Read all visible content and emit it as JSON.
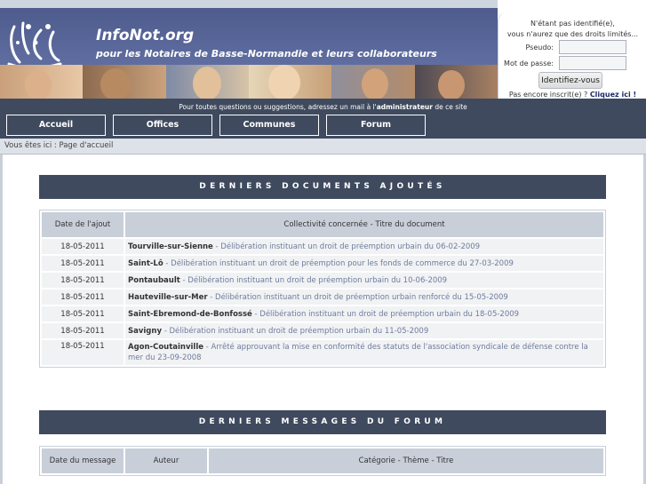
{
  "site": {
    "title": "InfoNot.org",
    "subtitle": "pour les Notaires de Basse-Normandie et leurs collaborateurs"
  },
  "login": {
    "message_line1": "N'étant pas identifié(e),",
    "message_line2": "vous n'aurez que des droits limités...",
    "pseudo_label": "Pseudo:",
    "password_label": "Mot de passe:",
    "submit_label": "Identifiez-vous",
    "signup_prompt": "Pas encore inscrit(e) ?",
    "signup_link": "Cliquez ici !"
  },
  "contact": {
    "prefix": "Pour toutes questions ou suggestions, adressez un mail à l'",
    "link": "administrateur",
    "suffix": " de ce site"
  },
  "nav": {
    "items": [
      "Accueil",
      "Offices",
      "Communes",
      "Forum"
    ]
  },
  "breadcrumb": "Vous êtes ici : Page d'accueil",
  "docs": {
    "heading": "DERNIERS DOCUMENTS AJOUTÉS",
    "columns": [
      "Date de l'ajout",
      "Collectivité concernée - Titre du document"
    ],
    "rows": [
      {
        "date": "18-05-2011",
        "commune": "Tourville-sur-Sienne",
        "title": " - Délibération instituant un droit de préemption urbain du 06-02-2009"
      },
      {
        "date": "18-05-2011",
        "commune": "Saint-Lô",
        "title": " - Délibération instituant un droit de préemption pour les fonds de commerce du 27-03-2009"
      },
      {
        "date": "18-05-2011",
        "commune": "Pontaubault",
        "title": " - Délibération instituant un droit de préemption urbain du 10-06-2009"
      },
      {
        "date": "18-05-2011",
        "commune": "Hauteville-sur-Mer",
        "title": " - Délibération instituant un droit de préemption urbain renforcé du 15-05-2009"
      },
      {
        "date": "18-05-2011",
        "commune": "Saint-Ebremond-de-Bonfossé",
        "title": " - Délibération instituant un droit de préemption urbain du 18-05-2009"
      },
      {
        "date": "18-05-2011",
        "commune": "Savigny",
        "title": " - Délibération instituant un droit de préemption urbain du 11-05-2009"
      },
      {
        "date": "18-05-2011",
        "commune": "Agon-Coutainville",
        "title": " - Arrêté approuvant la mise en conformité des statuts de l'association syndicale de défense contre la mer du 23-09-2008"
      }
    ]
  },
  "forum": {
    "heading": "DERNIERS MESSAGES DU FORUM",
    "columns": [
      "Date du message",
      "Auteur",
      "Catégorie - Thème - Titre"
    ]
  },
  "colors": {
    "nav_bg": "#3f4a5e",
    "header_bg": "#5f6da0",
    "table_header_bg": "#c9cfd9"
  }
}
